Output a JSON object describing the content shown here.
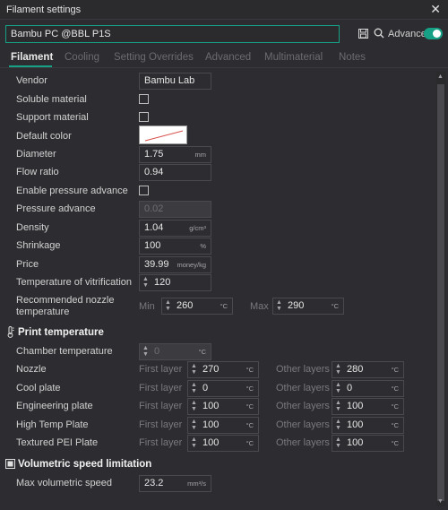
{
  "window": {
    "title": "Filament settings",
    "close": "✕"
  },
  "preset": {
    "name": "Bambu PC @BBL P1S",
    "advanced_label": "Advanced"
  },
  "tabs": [
    {
      "label": "Filament"
    },
    {
      "label": "Cooling"
    },
    {
      "label": "Setting Overrides"
    },
    {
      "label": "Advanced"
    },
    {
      "label": "Multimaterial"
    },
    {
      "label": "Notes"
    }
  ],
  "basic": {
    "vendor_label": "Vendor",
    "vendor_value": "Bambu Lab",
    "soluble_label": "Soluble material",
    "support_label": "Support material",
    "default_color_label": "Default color",
    "diameter_label": "Diameter",
    "diameter_value": "1.75",
    "diameter_unit": "mm",
    "flow_ratio_label": "Flow ratio",
    "flow_ratio_value": "0.94",
    "enable_pa_label": "Enable pressure advance",
    "pa_label": "Pressure advance",
    "pa_value": "0.02",
    "density_label": "Density",
    "density_value": "1.04",
    "density_unit": "g/cm³",
    "shrinkage_label": "Shrinkage",
    "shrinkage_value": "100",
    "shrinkage_unit": "%",
    "price_label": "Price",
    "price_value": "39.99",
    "price_unit": "money/kg",
    "vitrification_label": "Temperature of vitrification",
    "vitrification_value": "120",
    "nozzle_temp_label_1": "Recommended nozzle",
    "nozzle_temp_label_2": "temperature",
    "min_label": "Min",
    "min_value": "260",
    "max_label": "Max",
    "max_value": "290",
    "deg_unit": "°C"
  },
  "print_temperature": {
    "title": "Print temperature",
    "chamber_label": "Chamber temperature",
    "chamber_value": "0",
    "first_layer_label": "First layer",
    "other_layers_label": "Other layers",
    "rows": [
      {
        "label": "Nozzle",
        "first": "270",
        "other": "280"
      },
      {
        "label": "Cool plate",
        "first": "0",
        "other": "0"
      },
      {
        "label": "Engineering plate",
        "first": "100",
        "other": "100"
      },
      {
        "label": "High Temp Plate",
        "first": "100",
        "other": "100"
      },
      {
        "label": "Textured PEI Plate",
        "first": "100",
        "other": "100"
      }
    ]
  },
  "volumetric": {
    "title": "Volumetric speed limitation",
    "max_label": "Max volumetric speed",
    "max_value": "23.2",
    "max_unit": "mm³/s"
  },
  "colors": {
    "accent": "#16a085",
    "background": "#2d2d31"
  }
}
